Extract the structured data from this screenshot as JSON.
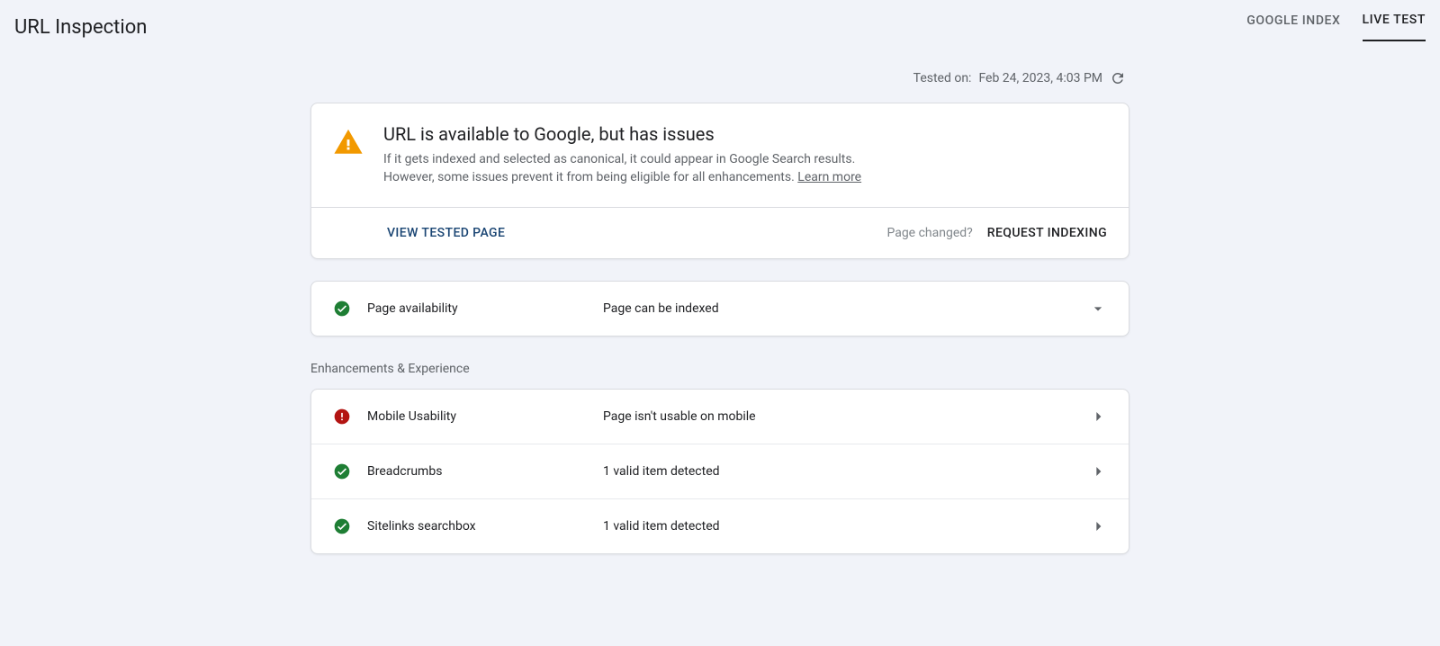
{
  "header": {
    "title": "URL Inspection",
    "tabs": {
      "google_index": "GOOGLE INDEX",
      "live_test": "LIVE TEST"
    }
  },
  "tested_on": {
    "prefix": "Tested on: ",
    "value": "Feb 24, 2023, 4:03 PM"
  },
  "status": {
    "heading": "URL is available to Google, but has issues",
    "desc1": "If it gets indexed and selected as canonical, it could appear in Google Search results.",
    "desc2": "However, some issues prevent it from being eligible for all enhancements. ",
    "learn_more": "Learn more",
    "view_tested_page": "VIEW TESTED PAGE",
    "page_changed": "Page changed?",
    "request_indexing": "REQUEST INDEXING"
  },
  "availability": {
    "label": "Page availability",
    "value": "Page can be indexed"
  },
  "enhancements_title": "Enhancements & Experience",
  "rows": {
    "mobile": {
      "label": "Mobile Usability",
      "value": "Page isn't usable on mobile"
    },
    "breadcrumbs": {
      "label": "Breadcrumbs",
      "value": "1 valid item detected"
    },
    "sitelinks": {
      "label": "Sitelinks searchbox",
      "value": "1 valid item detected"
    }
  }
}
